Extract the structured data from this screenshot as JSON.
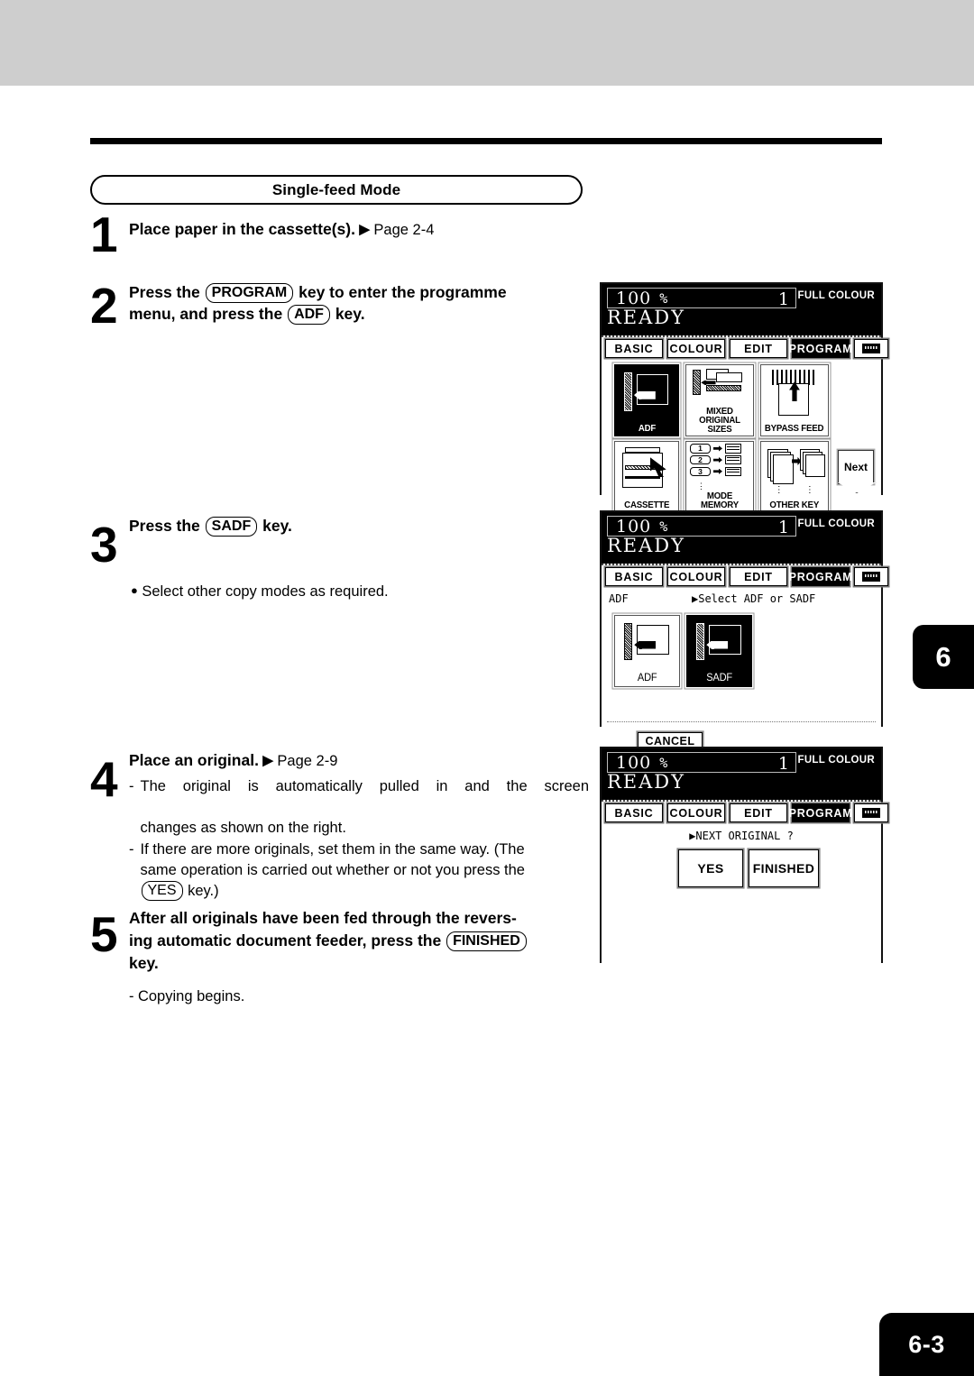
{
  "page": {
    "chapter_tab": "6",
    "footer_page": "6-3",
    "section_title": "Single-feed Mode"
  },
  "steps": [
    {
      "number": "1",
      "heading_bold": "Place paper in the cassette(s).",
      "arrow": "▶",
      "heading_ref": "Page 2-4"
    },
    {
      "number": "2",
      "line1_a": "Press the",
      "key1": "PROGRAM",
      "line1_b": "key to enter the programme",
      "line2_a": "menu, and press the",
      "key2": "ADF",
      "line2_b": "key."
    },
    {
      "number": "3",
      "line_a": "Press the",
      "key": "SADF",
      "line_b": "key.",
      "bullet": "●",
      "note": "Select other copy modes as required."
    },
    {
      "number": "4",
      "heading_bold": "Place an original.",
      "arrow": "▶",
      "heading_ref": "Page 2-9",
      "note1_dash": "-",
      "note1": "The original is automatically pulled in and the screen",
      "note1_cont": "changes as shown on the right.",
      "note2_dash": "-",
      "note2": "If there are more originals, set them in the same way.  (The",
      "note2_cont": "same operation is carried out whether or not you press the",
      "note2_key": "YES",
      "note2_tail": "key.)"
    },
    {
      "number": "5",
      "line1": "After all originals have been fed through the revers-",
      "line2_a": "ing automatic document feeder,  press the",
      "key": "FINISHED",
      "line3": "key.",
      "note_dash": "-",
      "note": "Copying begins."
    }
  ],
  "lcd_common": {
    "ratio": "100",
    "percent": "%",
    "copy_count": "1",
    "colour_mode": "FULL COLOUR",
    "status": "READY",
    "tabs": [
      {
        "label": "BASIC",
        "selected": false
      },
      {
        "label": "COLOUR",
        "selected": false
      },
      {
        "label": "EDIT",
        "selected": false
      },
      {
        "label": "PROGRAM",
        "selected": true
      }
    ],
    "tab_icon": "keyboard-icon"
  },
  "lcd_panel_1": {
    "buttons": [
      {
        "label": "ADF",
        "icon": "adf-icon",
        "selected": true
      },
      {
        "label_line1": "MIXED",
        "label_line2": "ORIGINAL SIZES",
        "icon": "mixed-sizes-icon",
        "selected": false
      },
      {
        "label": "BYPASS FEED",
        "icon": "bypass-feed-icon",
        "selected": false
      },
      {
        "label": "CASSETTE",
        "icon": "cassette-icon",
        "selected": false
      },
      {
        "label": "MODE MEMORY",
        "icon": "mode-memory-icon",
        "selected": false,
        "rows": [
          "1",
          "2",
          "3"
        ],
        "dots": "⋮"
      },
      {
        "label": "OTHER KEY",
        "icon": "other-key-icon",
        "selected": false,
        "dots": "⋮"
      }
    ],
    "next_button": "Next"
  },
  "lcd_panel_2": {
    "mode_label": "ADF",
    "prompt": "▶Select ADF or SADF",
    "buttons": [
      {
        "label": "ADF",
        "icon": "adf-icon",
        "selected": false
      },
      {
        "label": "SADF",
        "icon": "sadf-icon",
        "selected": true
      }
    ],
    "cancel_label": "CANCEL"
  },
  "lcd_panel_3": {
    "prompt": "▶NEXT ORIGINAL ?",
    "buttons": [
      {
        "label": "YES"
      },
      {
        "label": "FINISHED"
      }
    ]
  },
  "colors": {
    "header_band": "#cecece",
    "ink": "#000000",
    "paper": "#ffffff"
  }
}
